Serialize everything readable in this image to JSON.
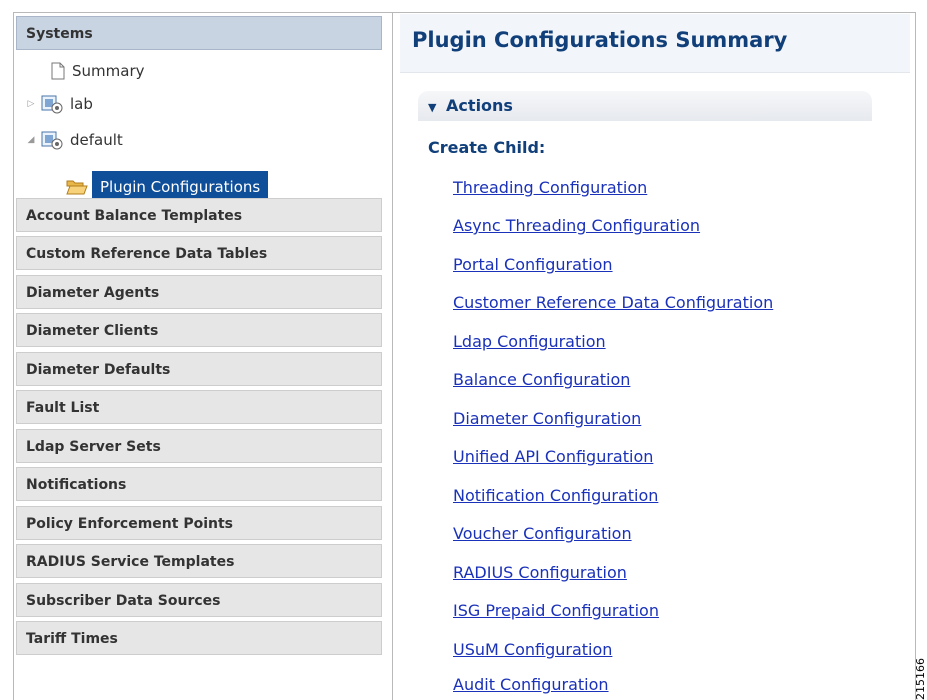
{
  "sidebar": {
    "systems_header": "Systems",
    "tree": {
      "summary": "Summary",
      "lab": "lab",
      "default": "default",
      "plugin_configurations": "Plugin Configurations"
    },
    "sections": [
      "Account Balance Templates",
      "Custom Reference Data Tables",
      "Diameter Agents",
      "Diameter Clients",
      "Diameter Defaults",
      "Fault List",
      "Ldap Server Sets",
      "Notifications",
      "Policy Enforcement Points",
      "RADIUS Service Templates",
      "Subscriber Data Sources",
      "Tariff Times"
    ]
  },
  "main": {
    "title": "Plugin Configurations Summary",
    "actions_label": "Actions",
    "create_child_label": "Create Child:",
    "links": [
      "Threading Configuration",
      "Async Threading Configuration",
      "Portal Configuration",
      "Customer Reference Data Configuration",
      "Ldap Configuration",
      "Balance Configuration",
      "Diameter Configuration",
      "Unified API Configuration",
      "Notification Configuration",
      "Voucher Configuration",
      "RADIUS Configuration",
      "ISG Prepaid Configuration",
      "USuM Configuration",
      "Audit Configuration"
    ]
  },
  "figure_id": "215166",
  "colors": {
    "link": "#1a31b9",
    "title": "#103f7a",
    "selected_bg": "#0f4f9a",
    "header_bg": "#e6e6e6",
    "active_header_bg": "#c9d4e3"
  }
}
